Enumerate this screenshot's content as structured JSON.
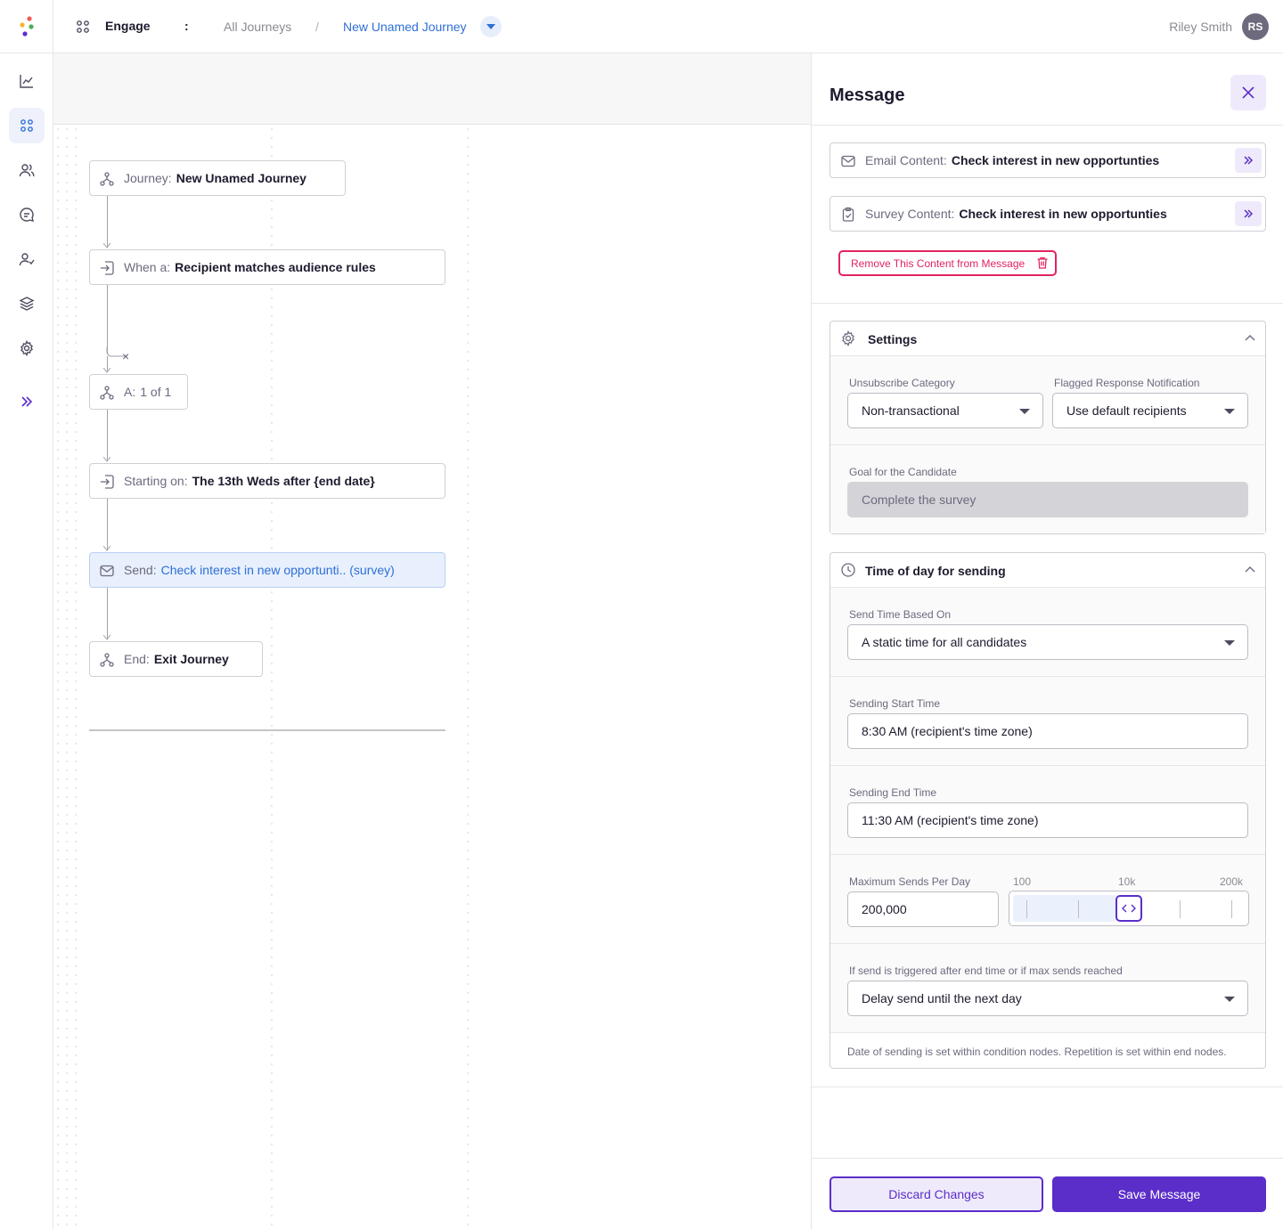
{
  "header": {
    "app_name": "Engage",
    "colon": ":",
    "crumb_all": "All Journeys",
    "crumb_sep": "/",
    "crumb_current": "New Unamed Journey",
    "user_name": "Riley Smith",
    "avatar_initials": "RS"
  },
  "rail": {
    "items": [
      "analytics-icon",
      "journeys-icon",
      "people-icon",
      "chat-icon",
      "user-check-icon",
      "layers-icon",
      "gear-icon",
      "expand-icon"
    ],
    "active": "journeys-icon"
  },
  "journey": {
    "nodes": [
      {
        "label": "Journey:",
        "value": "New Unamed Journey",
        "icon": "branch-icon"
      },
      {
        "label": "When a:",
        "value": "Recipient matches audience rules",
        "icon": "enter-icon"
      },
      {
        "label": "A:",
        "value": "1 of 1",
        "icon": "branch-icon"
      },
      {
        "label": "Starting on:",
        "value": "The 13th Weds after {end date}",
        "icon": "enter-icon"
      },
      {
        "label": "Send:",
        "value": "Check interest in new opportunti.. (survey)",
        "icon": "mail-icon"
      },
      {
        "label": "End:",
        "value": "Exit Journey",
        "icon": "branch-icon"
      }
    ],
    "branch_close": "×"
  },
  "panel": {
    "title": "Message",
    "email_content": {
      "label": "Email Content:",
      "value": "Check interest in new opportunties"
    },
    "survey_content": {
      "label": "Survey Content:",
      "value": "Check interest in new opportunties"
    },
    "remove_label": "Remove This Content from Message",
    "settings": {
      "title": "Settings",
      "unsubscribe_label": "Unsubscribe Category",
      "unsubscribe_value": "Non-transactional",
      "flagged_label": "Flagged Response Notification",
      "flagged_value": "Use default recipients",
      "goal_label": "Goal for the Candidate",
      "goal_value": "Complete the survey"
    },
    "timing": {
      "title": "Time of day for sending",
      "based_on_label": "Send Time Based On",
      "based_on_value": "A static time for all candidates",
      "start_label": "Sending Start Time",
      "start_value": "8:30 AM (recipient's time zone)",
      "end_label": "Sending End Time",
      "end_value": "11:30 AM (recipient's time zone)",
      "max_label": "Maximum Sends Per Day",
      "max_value": "200,000",
      "scale_min": "100",
      "scale_mid": "10k",
      "scale_max": "200k",
      "slider_fraction": 0.5,
      "overflow_label": "If send is triggered after end time or if max sends reached",
      "overflow_value": "Delay send until the next day",
      "footnote": "Date of sending is set within condition nodes.  Repetition is set within end nodes."
    },
    "discard_label": "Discard Changes",
    "save_label": "Save Message"
  },
  "colors": {
    "accent": "#5b2ec9",
    "link": "#2f6fd6",
    "danger": "#e0245e"
  }
}
